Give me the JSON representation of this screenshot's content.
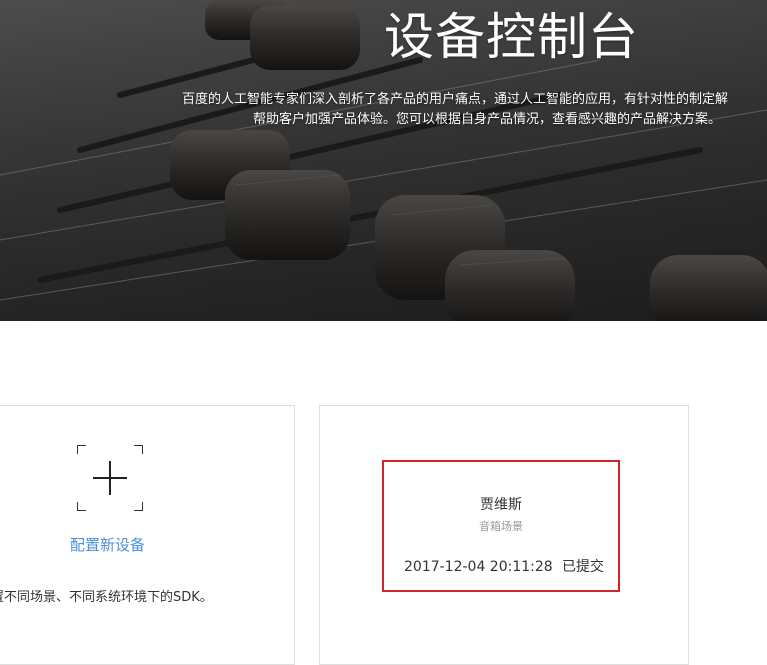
{
  "hero": {
    "title": "设备控制台",
    "description_line1": "百度的人工智能专家们深入剖析了各产品的用户痛点，通过人工智能的应用，有针对性的制定解",
    "description_line2": "帮助客户加强产品体验。您可以根据自身产品情况，查看感兴趣的产品解决方案。"
  },
  "add_card": {
    "icon": "add-plus-icon",
    "label": "配置新设备",
    "description": "置不同场景、不同系统环境下的SDK。"
  },
  "device_card": {
    "name": "贾维斯",
    "scene": "音箱场景",
    "timestamp": "2017-12-04 20:11:28",
    "status": "已提交"
  },
  "colors": {
    "link_blue": "#4a90d9",
    "highlight_red": "#d0252a",
    "border_gray": "#dedede"
  }
}
